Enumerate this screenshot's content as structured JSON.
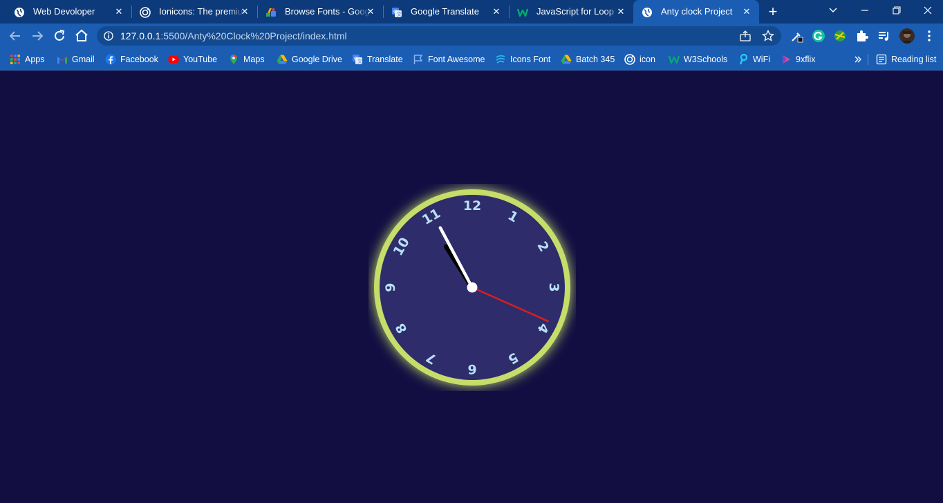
{
  "browser": {
    "tabs": [
      {
        "title": "Web Devoloper",
        "icon": "globe-icon"
      },
      {
        "title": "Ionicons: The premium",
        "icon": "ionicons-icon"
      },
      {
        "title": "Browse Fonts - Google",
        "icon": "google-fonts-icon"
      },
      {
        "title": "Google Translate",
        "icon": "translate-icon"
      },
      {
        "title": "JavaScript for Loop",
        "icon": "w3-icon"
      },
      {
        "title": "Anty clock Project",
        "icon": "globe-icon",
        "active": true
      }
    ],
    "url": {
      "host": "127.0.0.1",
      "path": ":5500/Anty%20Clock%20Project/index.html"
    },
    "bookmarks": [
      {
        "label": "Apps",
        "icon": "apps-grid-icon"
      },
      {
        "label": "Gmail",
        "icon": "gmail-icon"
      },
      {
        "label": "Facebook",
        "icon": "facebook-icon"
      },
      {
        "label": "YouTube",
        "icon": "youtube-icon"
      },
      {
        "label": "Maps",
        "icon": "maps-icon"
      },
      {
        "label": "Google Drive",
        "icon": "drive-icon"
      },
      {
        "label": "Translate",
        "icon": "translate-icon"
      },
      {
        "label": "Font Awesome",
        "icon": "flag-icon"
      },
      {
        "label": "Icons Font",
        "icon": "icons-font-icon"
      },
      {
        "label": "Batch 345",
        "icon": "drive-icon"
      },
      {
        "label": "icon",
        "icon": "ionicons-icon"
      },
      {
        "label": "W3Schools",
        "icon": "w3-icon"
      },
      {
        "label": "WiFi",
        "icon": "wifi-icon"
      },
      {
        "label": "9xflix",
        "icon": "play-icon"
      }
    ],
    "reading_list": "Reading list"
  },
  "clock": {
    "numbers": [
      "12",
      "1",
      "2",
      "3",
      "4",
      "5",
      "6",
      "7",
      "8",
      "9",
      "10",
      "11"
    ],
    "time": {
      "hour": 10,
      "minute": 55,
      "second": 19
    },
    "colors": {
      "page_bg": "#120e42",
      "ring": "#c6dd6a",
      "face": "#2e2c6b",
      "numbers": "#b8e0f5",
      "hour_hand": "#000000",
      "minute_hand": "#ffffff",
      "second_hand": "#d81f1f",
      "center_dot": "#ffffff"
    }
  }
}
